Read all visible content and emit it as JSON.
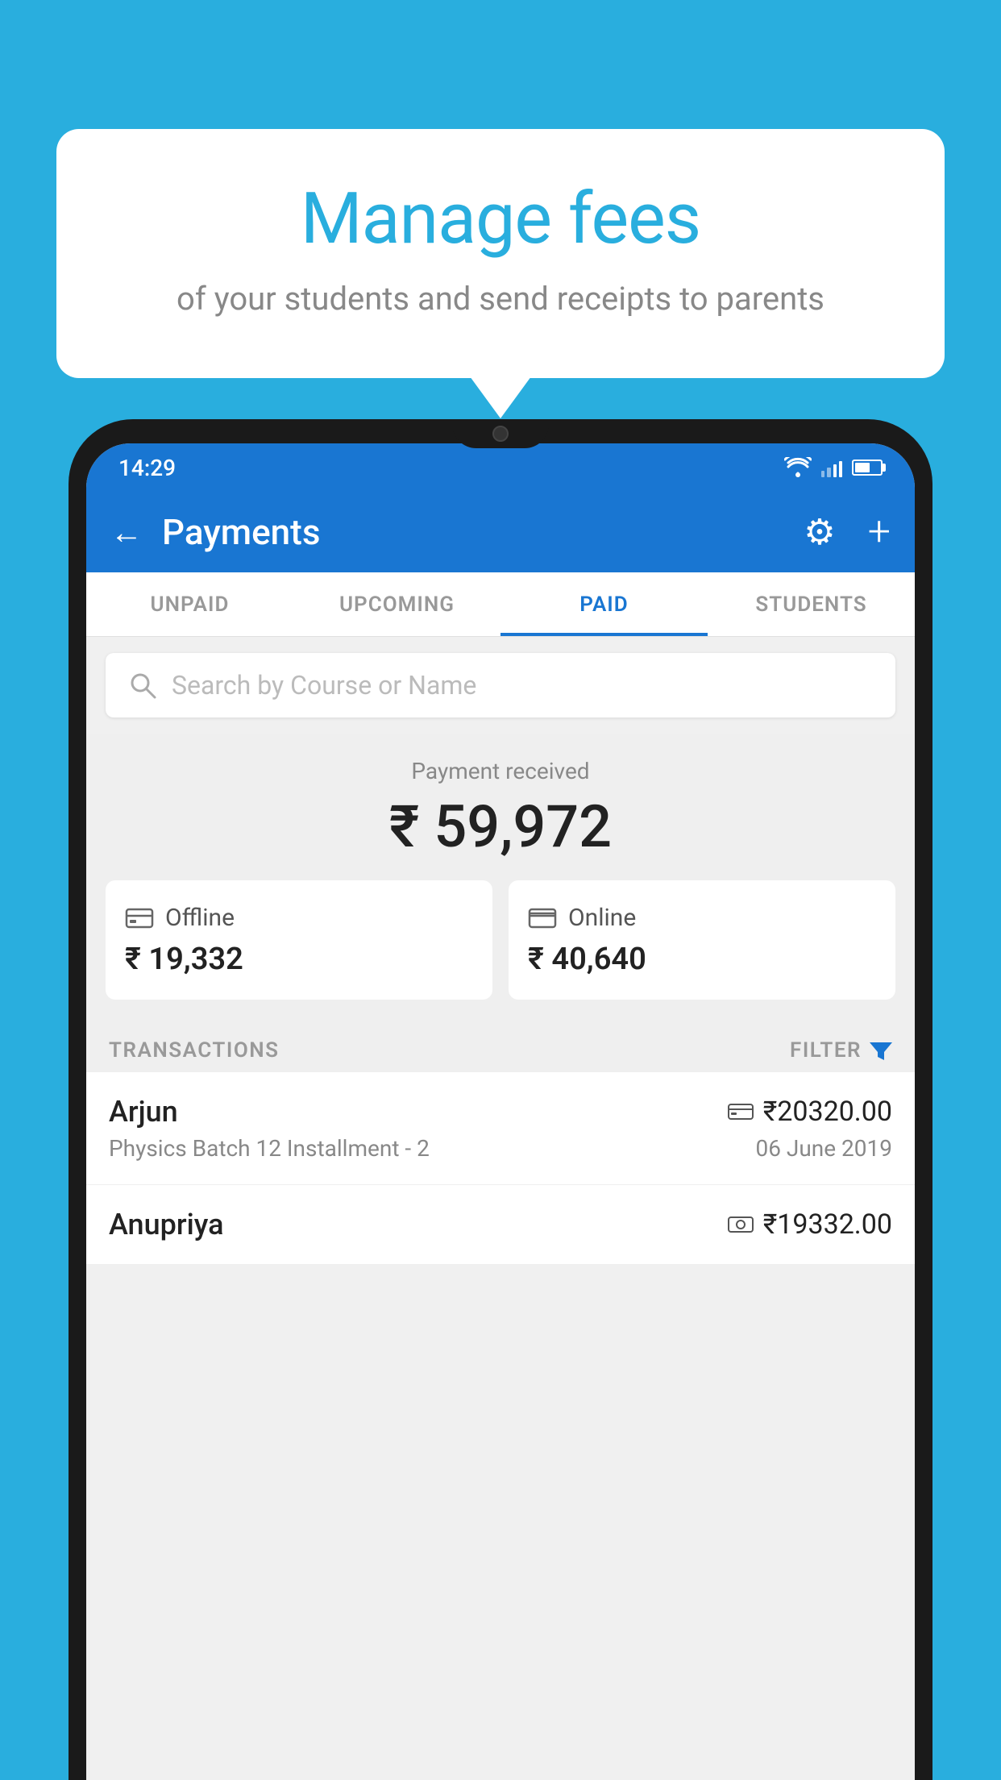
{
  "background_color": "#29AEDE",
  "bubble": {
    "title": "Manage fees",
    "subtitle": "of your students and send receipts to parents"
  },
  "status_bar": {
    "time": "14:29"
  },
  "header": {
    "title": "Payments",
    "back_label": "←",
    "settings_label": "⚙",
    "add_label": "+"
  },
  "tabs": [
    {
      "id": "unpaid",
      "label": "UNPAID",
      "active": false
    },
    {
      "id": "upcoming",
      "label": "UPCOMING",
      "active": false
    },
    {
      "id": "paid",
      "label": "PAID",
      "active": true
    },
    {
      "id": "students",
      "label": "STUDENTS",
      "active": false
    }
  ],
  "search": {
    "placeholder": "Search by Course or Name"
  },
  "payment_summary": {
    "label": "Payment received",
    "total": "₹ 59,972",
    "offline_label": "Offline",
    "offline_amount": "₹ 19,332",
    "online_label": "Online",
    "online_amount": "₹ 40,640"
  },
  "transactions": {
    "section_label": "TRANSACTIONS",
    "filter_label": "FILTER",
    "items": [
      {
        "name": "Arjun",
        "amount": "₹20320.00",
        "payment_type": "card",
        "course": "Physics Batch 12 Installment - 2",
        "date": "06 June 2019"
      },
      {
        "name": "Anupriya",
        "amount": "₹19332.00",
        "payment_type": "cash",
        "course": "",
        "date": ""
      }
    ]
  }
}
